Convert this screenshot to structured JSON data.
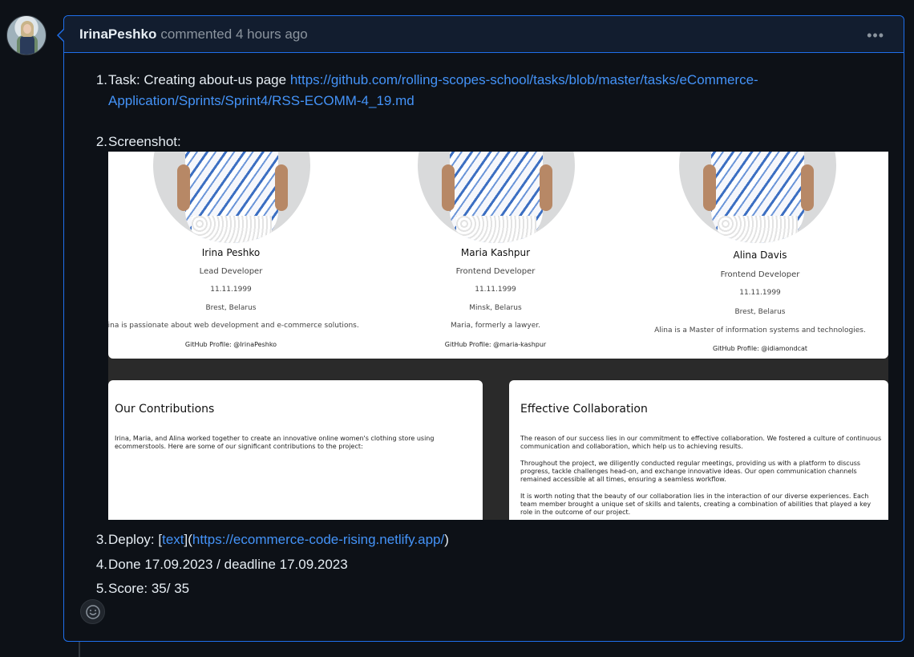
{
  "comment": {
    "author": "IrinaPeshko",
    "action": "commented",
    "time": "4 hours ago",
    "more_label": "•••"
  },
  "list": {
    "items": [
      {
        "num": "1.",
        "prefix": "Task: Creating about-us page ",
        "link_line1": "https://github.com/rolling-scopes-school/tasks/blob/master/tasks/eCommerce-",
        "link_line2": "Application/Sprints/Sprint4/RSS-ECOMM-4_19.md"
      },
      {
        "num": "2.",
        "text": "Screenshot:"
      },
      {
        "num": "3.",
        "prefix": "Deploy: [",
        "link_text": "text",
        "mid": "](",
        "link_url": "https://ecommerce-code-rising.netlify.app/",
        "suffix": ")"
      },
      {
        "num": "4.",
        "text": "Done 17.09.2023 / deadline 17.09.2023"
      },
      {
        "num": "5.",
        "text": "Score: 35/ 35"
      }
    ]
  },
  "screenshot": {
    "members": [
      {
        "name": "Irina Peshko",
        "role": "Lead Developer",
        "date": "11.11.1999",
        "city": "Brest, Belarus",
        "bio": "Irina is passionate about web development and e-commerce solutions.",
        "github": "GitHub Profile: @IrinaPeshko"
      },
      {
        "name": "Maria Kashpur",
        "role": "Frontend Developer",
        "date": "11.11.1999",
        "city": "Minsk, Belarus",
        "bio": "Maria, formerly a lawyer.",
        "github": "GitHub Profile: @maria-kashpur"
      },
      {
        "name": "Alina Davis",
        "role": "Frontend Developer",
        "date": "11.11.1999",
        "city": "Brest, Belarus",
        "bio": "Alina is a Master of information systems and technologies.",
        "github": "GitHub Profile: @idiamondcat"
      }
    ],
    "contributions": {
      "title": "Our Contributions",
      "text": "Irina, Maria, and Alina worked together to create an innovative online women's clothing store using ecommerstools. Here are some of our significant contributions to the project:"
    },
    "collaboration": {
      "title": "Effective Collaboration",
      "p1": "The reason of our success lies in our commitment to effective collaboration. We fostered a culture of continuous communication and collaboration, which help us to achieving results.",
      "p2": "Throughout the project, we diligently conducted regular meetings, providing us with a platform to discuss progress, tackle challenges head-on, and exchange innovative ideas. Our open communication channels remained accessible at all times, ensuring a seamless workflow.",
      "p3": "It is worth noting that the beauty of our collaboration lies in the interaction of our diverse experiences. Each team member brought a unique set of skills and talents, creating a combination of abilities that played a key role in the outcome of our project."
    }
  },
  "icons": {
    "reaction": "smiley-icon",
    "more": "kebab-icon"
  },
  "colors": {
    "accent": "#1f6feb",
    "link": "#4493f8",
    "bg": "#0d1117",
    "header_bg": "#121d2f"
  }
}
